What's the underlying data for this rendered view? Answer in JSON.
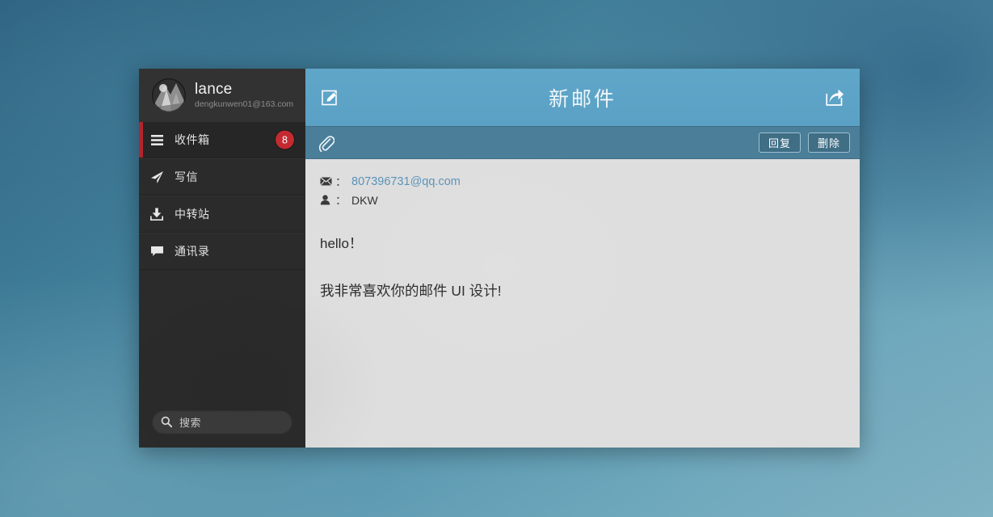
{
  "window": {
    "title": "新邮件"
  },
  "sidebar": {
    "profile": {
      "name": "lance",
      "email": "dengkunwen01@163.com",
      "avatar_icon": "user-avatar-photo"
    },
    "items": [
      {
        "label": "收件箱",
        "icon": "hamburger-icon",
        "badge": "8",
        "active": true
      },
      {
        "label": "写信",
        "icon": "paper-plane-icon",
        "badge": "",
        "active": false
      },
      {
        "label": "中转站",
        "icon": "download-icon",
        "badge": "",
        "active": false
      },
      {
        "label": "通讯录",
        "icon": "chat-bubble-icon",
        "badge": "",
        "active": false
      }
    ],
    "search": {
      "placeholder": "搜索",
      "icon": "search-icon"
    }
  },
  "topbar": {
    "compose_icon": "compose-pencil-icon",
    "share_icon": "share-forward-icon"
  },
  "subbar": {
    "attach_icon": "paperclip-icon",
    "reply_label": "回复",
    "delete_label": "删除"
  },
  "message": {
    "to_icon": "envelope-icon",
    "to_colon": "：",
    "to_address": "807396731@qq.com",
    "from_icon": "person-icon",
    "from_colon": "：",
    "from_name": "DKW",
    "body_line1": "hello！",
    "body_line2": "我非常喜欢你的邮件 UI 设计!"
  },
  "colors": {
    "header_blue": "#5aa1c5",
    "subbar_blue": "#4a7e99",
    "sidebar_dark": "#2b2b2b",
    "accent_red": "#b3242c",
    "badge_red": "#c32a31",
    "content_gray": "#dedede",
    "link_blue": "#5a93b8"
  }
}
